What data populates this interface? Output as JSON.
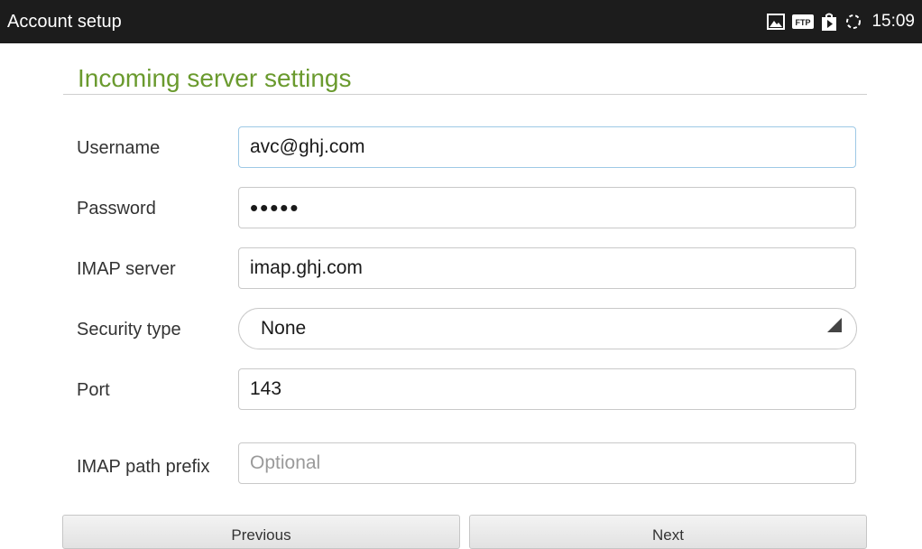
{
  "status_bar": {
    "title": "Account setup",
    "time": "15:09",
    "icons": [
      "image-icon",
      "ftp-icon",
      "play-store-icon",
      "sync-icon"
    ]
  },
  "section": {
    "title": "Incoming server settings"
  },
  "form": {
    "username": {
      "label": "Username",
      "value": "avc@ghj.com"
    },
    "password": {
      "label": "Password",
      "value": "•••••"
    },
    "imap_server": {
      "label": "IMAP server",
      "value": "imap.ghj.com"
    },
    "security_type": {
      "label": "Security type",
      "selected": "None"
    },
    "port": {
      "label": "Port",
      "value": "143"
    },
    "imap_path_prefix": {
      "label": "IMAP path prefix",
      "placeholder": "Optional"
    }
  },
  "buttons": {
    "previous": "Previous",
    "next": "Next"
  },
  "colors": {
    "title_green": "#6a9a2e",
    "status_bar_bg": "#1c1c1c",
    "focus_border": "#9ec9e6"
  }
}
